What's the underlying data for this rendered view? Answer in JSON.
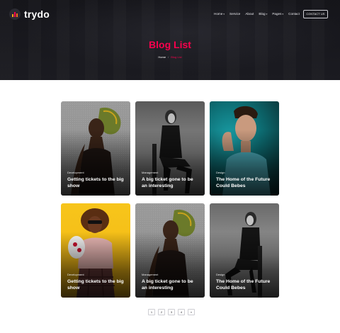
{
  "header": {
    "logo_text": "trydo",
    "nav": [
      {
        "label": "Home",
        "has_dropdown": true
      },
      {
        "label": "Service",
        "has_dropdown": false
      },
      {
        "label": "About",
        "has_dropdown": false
      },
      {
        "label": "Blog",
        "has_dropdown": true
      },
      {
        "label": "Pages",
        "has_dropdown": true
      },
      {
        "label": "Contact",
        "has_dropdown": false
      }
    ],
    "contact_button": "CONTACT US"
  },
  "hero": {
    "title": "Blog List",
    "breadcrumb": {
      "home": "Home",
      "separator": "/",
      "current": "Blog List"
    }
  },
  "colors": {
    "accent": "#f9004d",
    "dark": "#1c1c22"
  },
  "posts": [
    {
      "category": "Development",
      "title": "Getting tickets to the big show",
      "image": "woman-headwrap-gray"
    },
    {
      "category": "Management",
      "title": "A big ticket gone to be an interesting",
      "image": "woman-chair-bw"
    },
    {
      "category": "Design",
      "title": "The Home of the Future Could Bebes",
      "image": "man-teal"
    },
    {
      "category": "Development",
      "title": "Getting tickets to the big show",
      "image": "woman-yellow"
    },
    {
      "category": "Management",
      "title": "A big ticket gone to be an interesting",
      "image": "woman-headwrap-gray"
    },
    {
      "category": "Design",
      "title": "The Home of the Future Could Bebes",
      "image": "woman-chair-bw"
    }
  ],
  "pagination": {
    "pages": [
      "1",
      "2",
      "3",
      "4"
    ],
    "next": "»"
  }
}
